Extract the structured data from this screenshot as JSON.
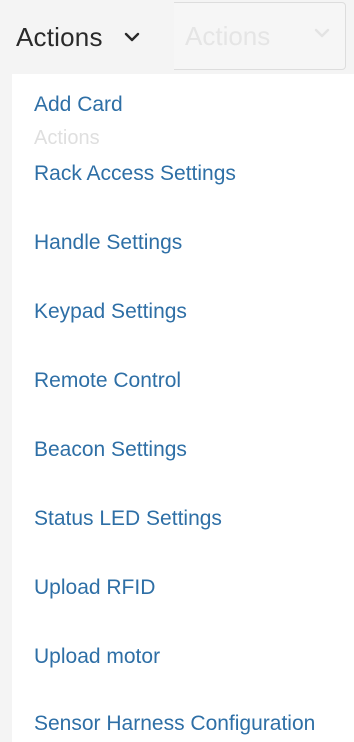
{
  "dropdown": {
    "label": "Actions",
    "chevron_icon": "chevron-down-icon"
  },
  "background_select": {
    "label": "Actions"
  },
  "background_tooltip": "Actions",
  "menu": {
    "items": [
      {
        "label": "Add Card"
      },
      {
        "label": "Rack Access Settings"
      },
      {
        "label": "Handle Settings"
      },
      {
        "label": "Keypad Settings"
      },
      {
        "label": "Remote Control"
      },
      {
        "label": "Beacon Settings"
      },
      {
        "label": "Status LED Settings"
      },
      {
        "label": "Upload RFID"
      },
      {
        "label": "Upload motor"
      },
      {
        "label": "Sensor Harness Configuration"
      }
    ]
  },
  "colors": {
    "link": "#2e6fa6",
    "trigger_text": "#2a2a2a",
    "menu_background": "#ffffff",
    "page_background": "#f4f4f4"
  }
}
